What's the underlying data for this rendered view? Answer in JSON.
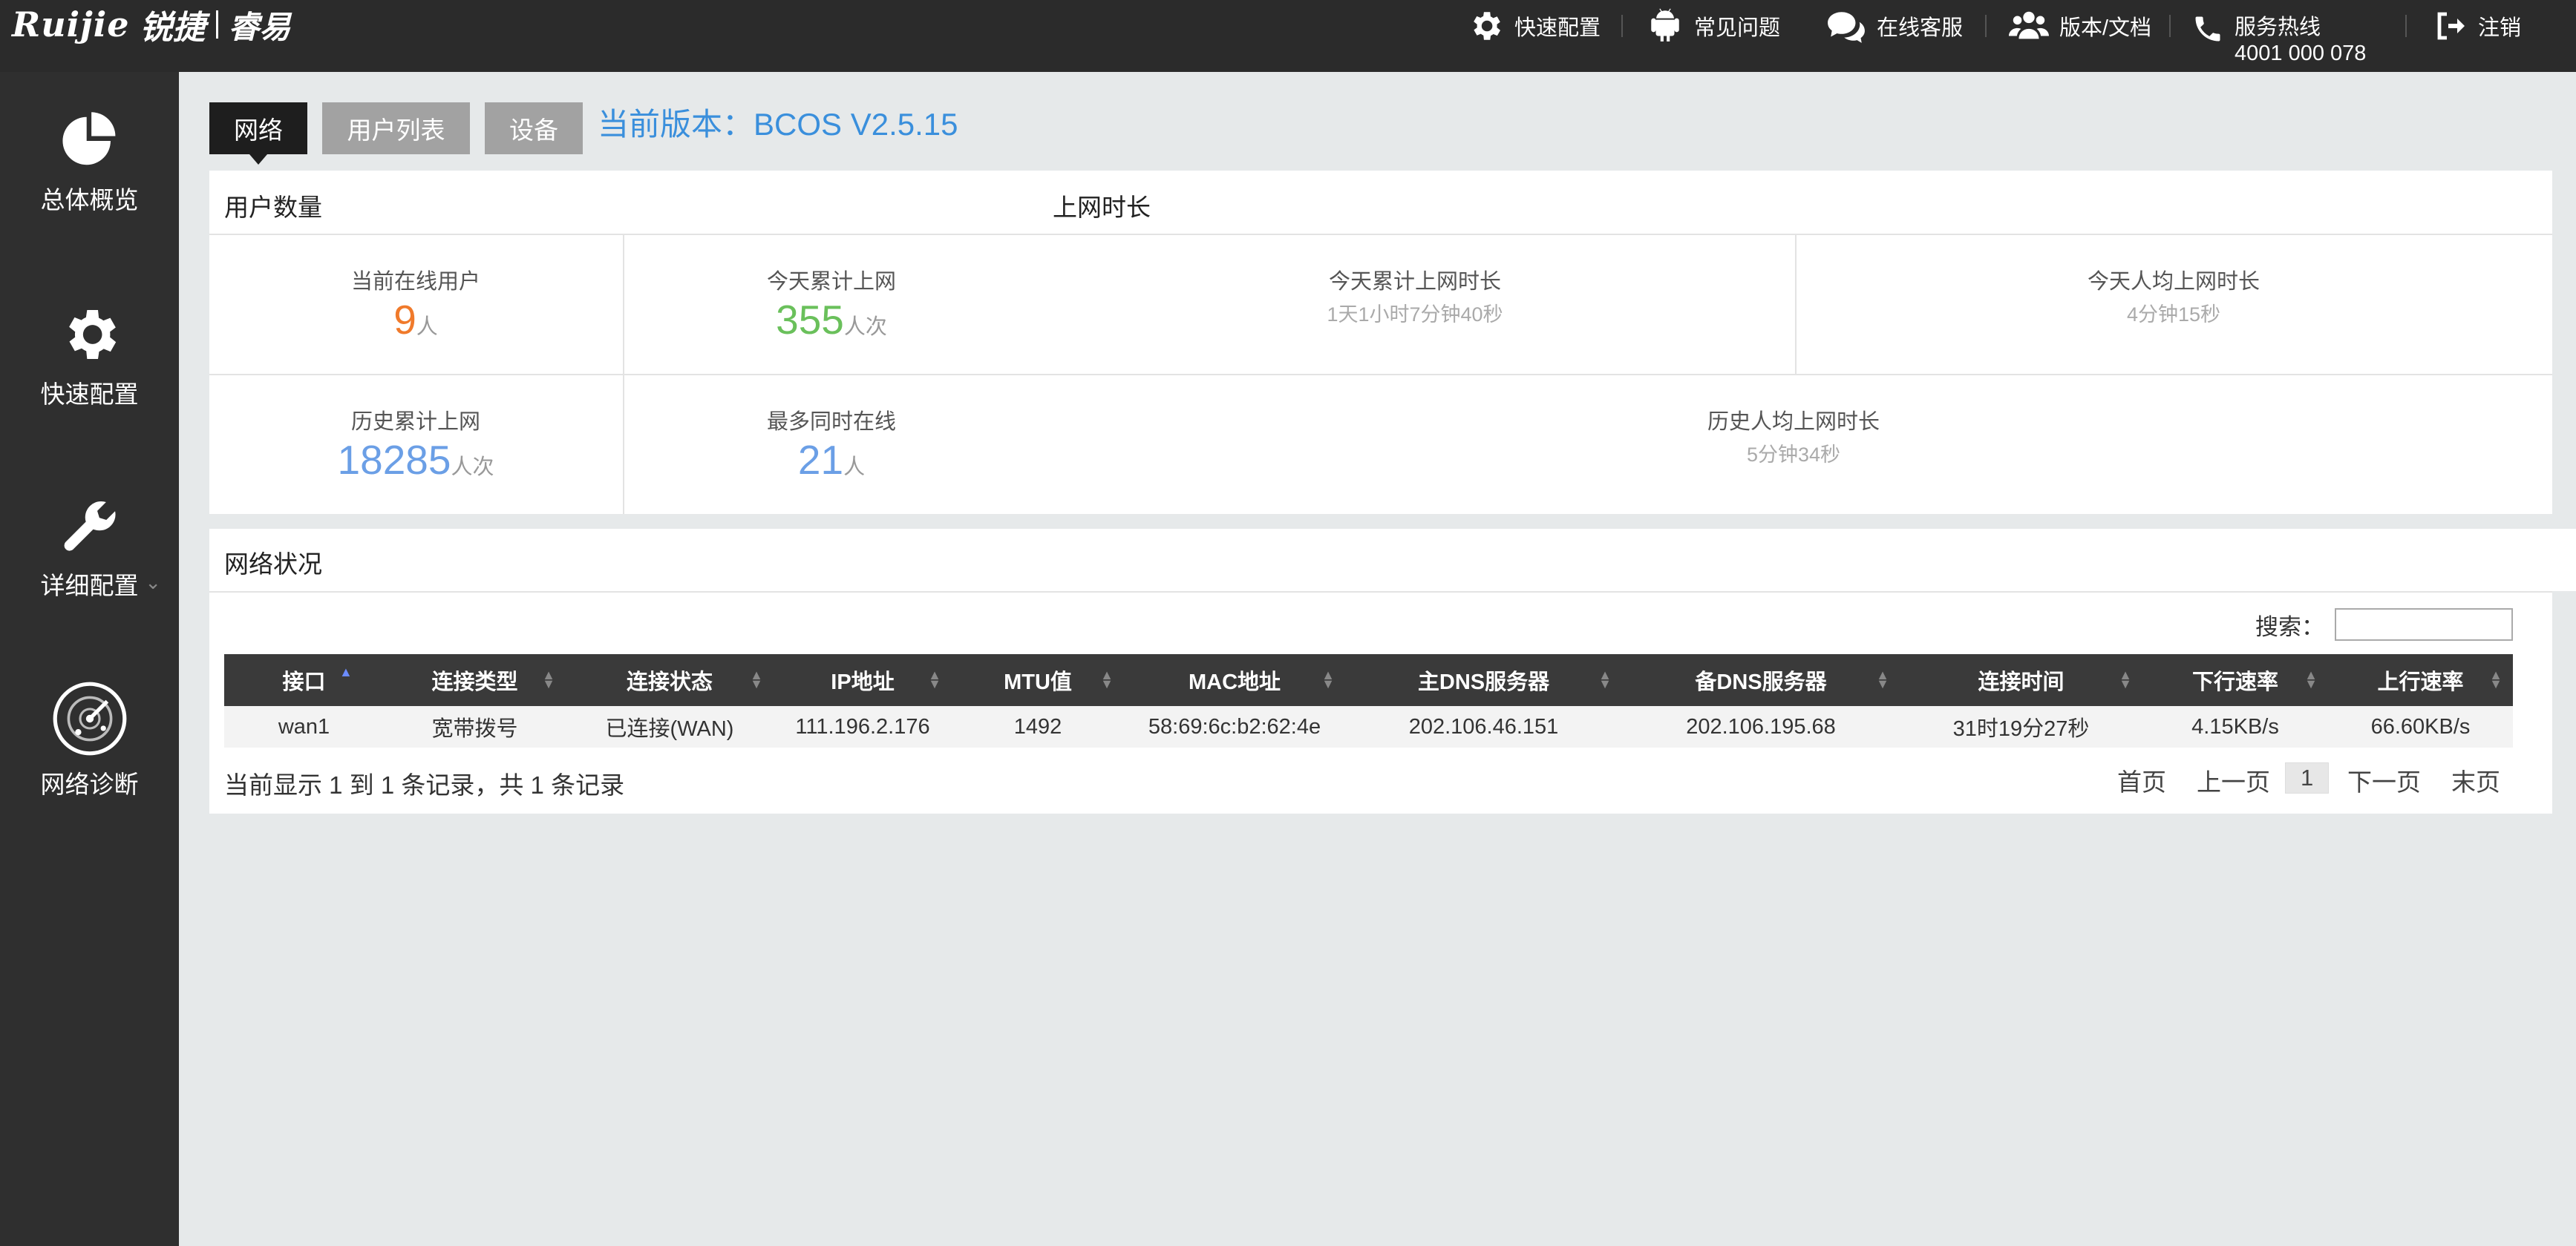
{
  "header": {
    "logo_brand": "Ruijie",
    "logo_brand_cn": "锐捷",
    "logo_sub": "睿易",
    "nav": [
      {
        "icon": "gear-icon",
        "label": "快速配置"
      },
      {
        "icon": "android-icon",
        "label": "常见问题"
      },
      {
        "icon": "chat-icon",
        "label": "在线客服"
      },
      {
        "icon": "users-icon",
        "label": "版本/文档"
      },
      {
        "icon": "phone-icon",
        "label": "服务热线",
        "sublabel": "4001 000 078"
      },
      {
        "icon": "logout-icon",
        "label": "注销"
      }
    ]
  },
  "sidebar": {
    "items": [
      {
        "icon": "pie-chart-icon",
        "label": "总体概览"
      },
      {
        "icon": "gear-icon",
        "label": "快速配置"
      },
      {
        "icon": "wrench-icon",
        "label": "详细配置",
        "has_dropdown": true
      },
      {
        "icon": "radar-icon",
        "label": "网络诊断"
      }
    ]
  },
  "tabs": [
    {
      "label": "网络",
      "active": true
    },
    {
      "label": "用户列表",
      "active": false
    },
    {
      "label": "设备",
      "active": false
    }
  ],
  "version_text": "当前版本：BCOS V2.5.15",
  "stats_panel": {
    "users_title": "用户数量",
    "time_title": "上网时长",
    "online_users": {
      "label": "当前在线用户",
      "value": "9",
      "unit": "人"
    },
    "today_total": {
      "label": "今天累计上网",
      "value": "355",
      "unit": "人次"
    },
    "today_total_time": {
      "label": "今天累计上网时长",
      "value": "1天1小时7分钟40秒"
    },
    "today_avg_time": {
      "label": "今天人均上网时长",
      "value": "4分钟15秒"
    },
    "history_total": {
      "label": "历史累计上网",
      "value": "18285",
      "unit": "人次"
    },
    "max_online": {
      "label": "最多同时在线",
      "value": "21",
      "unit": "人"
    },
    "history_avg_time": {
      "label": "历史人均上网时长",
      "value": "5分钟34秒"
    }
  },
  "network_status": {
    "title": "网络状况",
    "search_label": "搜索：",
    "search_value": "",
    "columns": [
      "接口",
      "连接类型",
      "连接状态",
      "IP地址",
      "MTU值",
      "MAC地址",
      "主DNS服务器",
      "备DNS服务器",
      "连接时间",
      "下行速率",
      "上行速率"
    ],
    "rows": [
      [
        "wan1",
        "宽带拨号",
        "已连接(WAN)",
        "111.196.2.176",
        "1492",
        "58:69:6c:b2:62:4e",
        "202.106.46.151",
        "202.106.195.68",
        "31时19分27秒",
        "4.15KB/s",
        "66.60KB/s"
      ]
    ],
    "record_info": "当前显示 1 到 1 条记录，共 1 条记录",
    "pager": {
      "first": "首页",
      "prev": "上一页",
      "current": "1",
      "next": "下一页",
      "last": "末页"
    }
  }
}
